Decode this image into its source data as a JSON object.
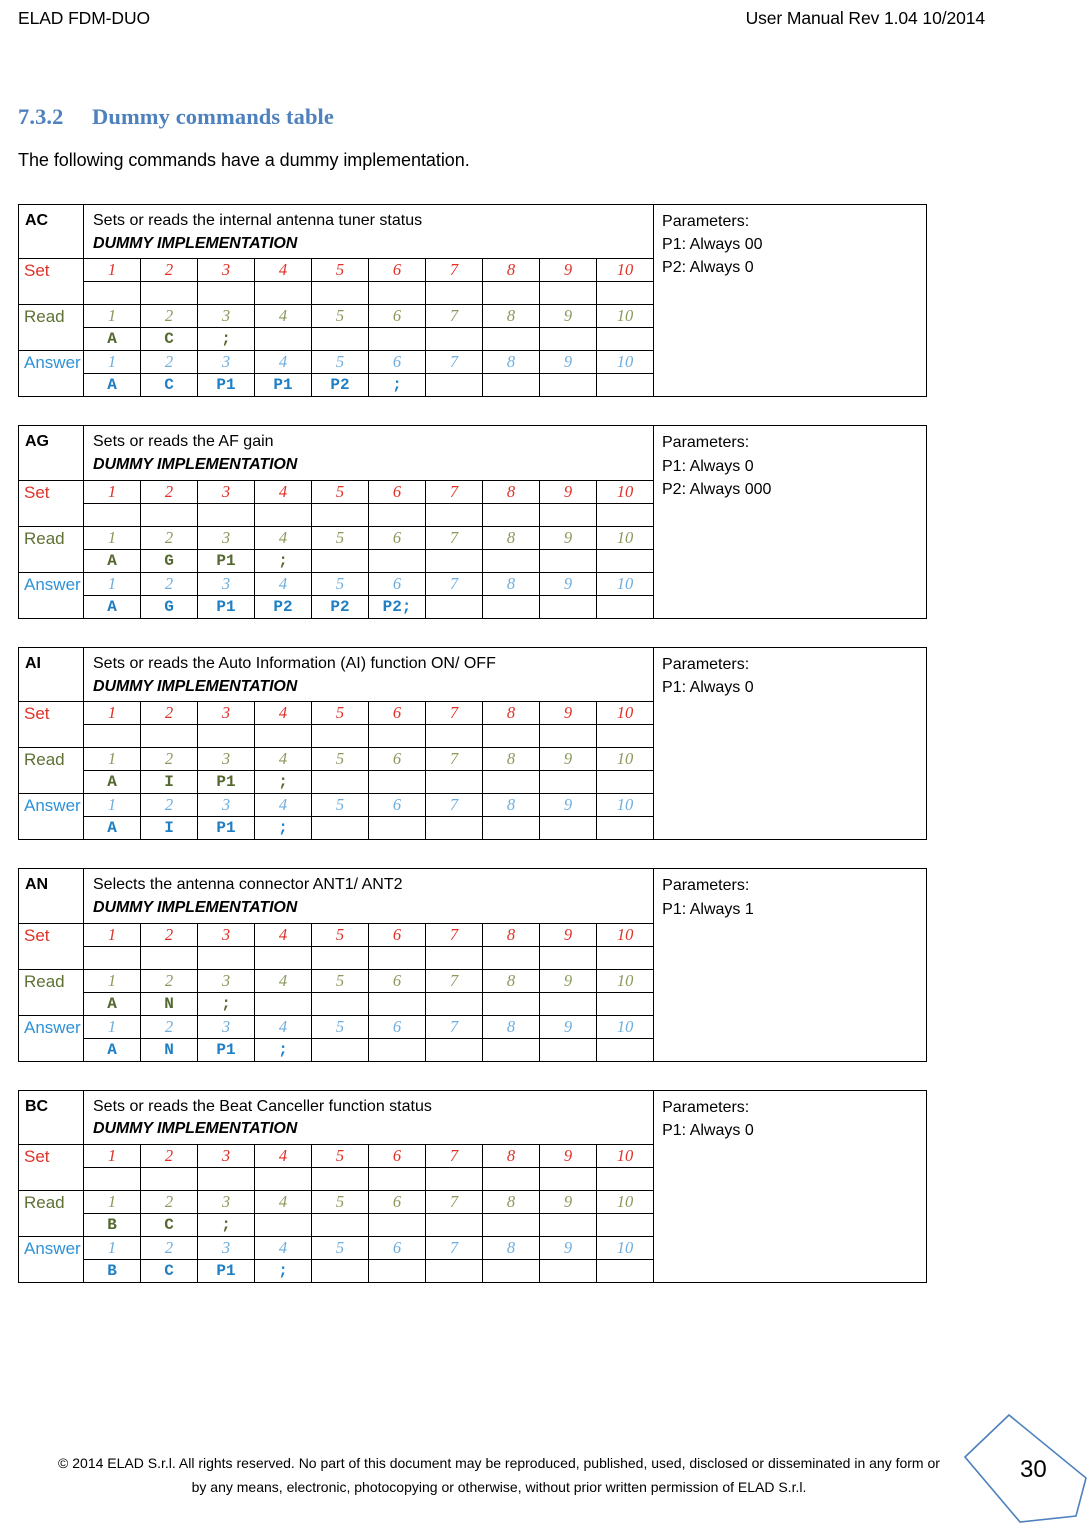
{
  "header": {
    "left": "ELAD FDM-DUO",
    "right": "User Manual Rev 1.04   10/2014"
  },
  "heading": {
    "number": "7.3.2",
    "title": "Dummy commands table",
    "color": "#4E81BD"
  },
  "intro": "The following commands have a dummy implementation.",
  "row_labels": {
    "set": "Set",
    "read": "Read",
    "answer": "Answer"
  },
  "params_title": "Parameters:",
  "dummy_note": "DUMMY IMPLEMENTATION",
  "index_row": [
    "1",
    "2",
    "3",
    "4",
    "5",
    "6",
    "7",
    "8",
    "9",
    "10"
  ],
  "colors": {
    "set": "#E03127",
    "read": "#5E7033",
    "answer": "#2E92D8",
    "heading": "#4E81BD",
    "badge": "#4E81BD"
  },
  "tables": [
    {
      "code": "AC",
      "description": "Sets or reads the internal antenna tuner status",
      "params": [
        "P1: Always 00",
        "P2: Always 0"
      ],
      "set_values": [
        "",
        "",
        "",
        "",
        "",
        "",
        "",
        "",
        "",
        ""
      ],
      "read_values": [
        "A",
        "C",
        ";",
        "",
        "",
        "",
        "",
        "",
        "",
        ""
      ],
      "answer_values": [
        "A",
        "C",
        "P1",
        "P1",
        "P2",
        ";",
        "",
        "",
        "",
        ""
      ]
    },
    {
      "code": "AG",
      "description": "Sets or reads the AF gain",
      "params": [
        "P1: Always 0",
        "P2: Always 000"
      ],
      "set_values": [
        "",
        "",
        "",
        "",
        "",
        "",
        "",
        "",
        "",
        ""
      ],
      "read_values": [
        "A",
        "G",
        "P1",
        ";",
        "",
        "",
        "",
        "",
        "",
        ""
      ],
      "answer_values": [
        "A",
        "G",
        "P1",
        "P2",
        "P2",
        "P2;",
        "",
        "",
        "",
        ""
      ]
    },
    {
      "code": "AI",
      "description": "Sets or reads the Auto Information (AI) function ON/ OFF",
      "params": [
        "P1: Always 0"
      ],
      "set_values": [
        "",
        "",
        "",
        "",
        "",
        "",
        "",
        "",
        "",
        ""
      ],
      "read_values": [
        "A",
        "I",
        "P1",
        ";",
        "",
        "",
        "",
        "",
        "",
        ""
      ],
      "answer_values": [
        "A",
        "I",
        "P1",
        ";",
        "",
        "",
        "",
        "",
        "",
        ""
      ]
    },
    {
      "code": "AN",
      "description": "Selects the antenna connector ANT1/ ANT2",
      "params": [
        "P1: Always 1"
      ],
      "set_values": [
        "",
        "",
        "",
        "",
        "",
        "",
        "",
        "",
        "",
        ""
      ],
      "read_values": [
        "A",
        "N",
        ";",
        "",
        "",
        "",
        "",
        "",
        "",
        ""
      ],
      "answer_values": [
        "A",
        "N",
        "P1",
        ";",
        "",
        "",
        "",
        "",
        "",
        ""
      ]
    },
    {
      "code": "BC",
      "description": "Sets or reads the Beat Canceller function status",
      "params": [
        "P1: Always 0"
      ],
      "set_values": [
        "",
        "",
        "",
        "",
        "",
        "",
        "",
        "",
        "",
        ""
      ],
      "read_values": [
        "B",
        "C",
        ";",
        "",
        "",
        "",
        "",
        "",
        "",
        ""
      ],
      "answer_values": [
        "B",
        "C",
        "P1",
        ";",
        "",
        "",
        "",
        "",
        "",
        ""
      ]
    }
  ],
  "footer": {
    "line1": "© 2014 ELAD S.r.l. All rights reserved. No part of this document may be reproduced, published, used, disclosed or disseminated in any form or",
    "line2": "by any means, electronic, photocopying or otherwise, without prior written permission of ELAD S.r.l.",
    "page_number": "30"
  }
}
